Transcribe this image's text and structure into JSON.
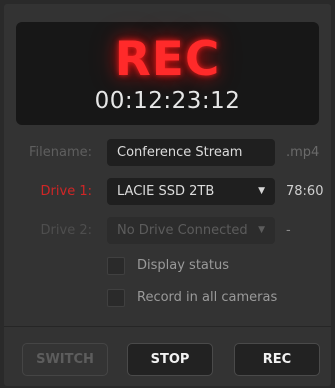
{
  "display": {
    "status": "REC",
    "timecode": "00:12:23:12"
  },
  "filename": {
    "label": "Filename:",
    "value": "Conference Stream",
    "extension": ".mp4"
  },
  "drive1": {
    "label": "Drive 1:",
    "selected": "LACIE SSD 2TB",
    "remaining": "78:60"
  },
  "drive2": {
    "label": "Drive 2:",
    "selected": "No Drive Connected",
    "remaining": "-"
  },
  "options": {
    "display_status": {
      "label": "Display status",
      "checked": false
    },
    "record_all": {
      "label": "Record in all cameras",
      "checked": false
    }
  },
  "buttons": {
    "switch": "SWITCH",
    "stop": "STOP",
    "rec": "REC"
  },
  "colors": {
    "rec_red": "#ff2a2a",
    "drive_active_label": "#d02626"
  },
  "icons": {
    "dropdown": "chevron-down-icon"
  }
}
